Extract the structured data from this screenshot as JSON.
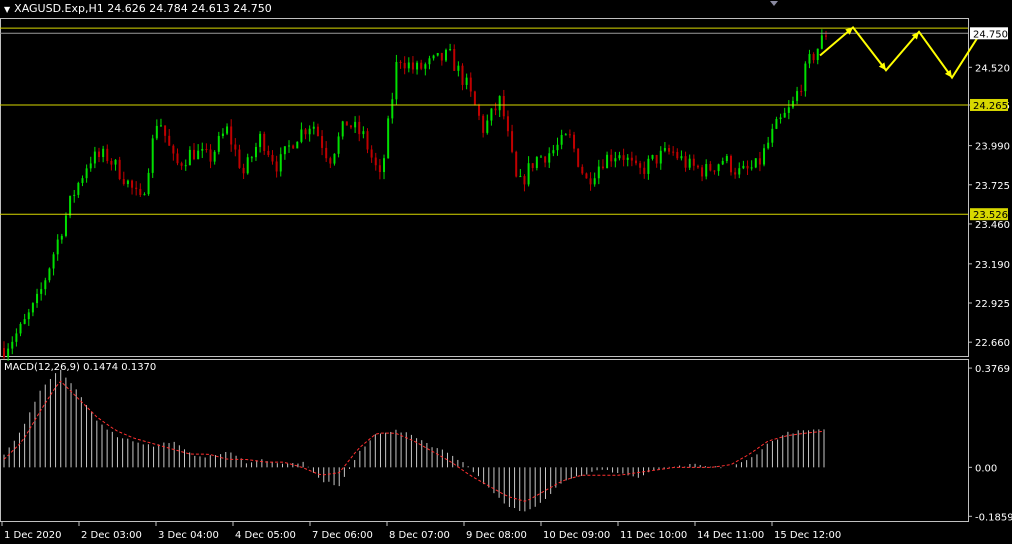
{
  "header": {
    "symbol_line": "XAGUSD.Exp,H1  24.626 24.784 24.613 24.750",
    "macd_label": "MACD(12,26,9) 0.1474 0.1370"
  },
  "colors": {
    "background": "#000000",
    "bull_candle": "#00e000",
    "bear_candle": "#c00000",
    "level_line": "#d8d800",
    "forecast_arrow": "#ffff00",
    "histogram": "#c8c8c8",
    "signal_line": "#ff3030",
    "axis_text": "#ffffff"
  },
  "chart_data": [
    {
      "type": "candlestick",
      "title": "XAGUSD.Exp,H1",
      "price_ticks": [
        "24.520",
        "24.265",
        "23.990",
        "23.725",
        "23.460",
        "23.190",
        "22.925",
        "22.660"
      ],
      "current_price_label": "24.750",
      "level_labels": [
        "24.265",
        "23.526"
      ],
      "levels": [
        24.785,
        24.265,
        23.526
      ],
      "ylim": [
        22.58,
        24.84
      ],
      "x_ticks": [
        "1 Dec 2020",
        "2 Dec 03:00",
        "3 Dec 04:00",
        "4 Dec 05:00",
        "7 Dec 06:00",
        "8 Dec 07:00",
        "9 Dec 08:00",
        "10 Dec 09:00",
        "11 Dec 10:00",
        "14 Dec 11:00",
        "15 Dec 12:00"
      ],
      "close_path": [
        22.62,
        22.75,
        22.95,
        23.3,
        23.65,
        23.9,
        23.92,
        23.78,
        23.6,
        24.2,
        23.85,
        23.95,
        23.9,
        24.1,
        23.8,
        24.05,
        23.85,
        24.05,
        24.15,
        23.9,
        24.15,
        24.05,
        23.75,
        24.6,
        24.5,
        24.55,
        24.6,
        24.4,
        24.1,
        24.3,
        23.7,
        23.9,
        23.95,
        24.05,
        23.75,
        23.9,
        23.95,
        23.8,
        23.9,
        23.95,
        23.85,
        23.82,
        23.9,
        23.8,
        23.85,
        24.1,
        24.25,
        24.55,
        24.75
      ],
      "forecast_path": [
        24.6,
        24.79,
        24.5,
        24.76,
        24.45,
        24.8
      ]
    },
    {
      "type": "bar",
      "title": "MACD(12,26,9)",
      "ticks": [
        "0.3769",
        "0.00",
        "-0.1859"
      ],
      "ylim": [
        -0.2,
        0.4
      ],
      "macd_path": [
        0.05,
        0.15,
        0.3,
        0.37,
        0.28,
        0.18,
        0.12,
        0.1,
        0.08,
        0.1,
        0.05,
        0.04,
        0.06,
        0.02,
        0.03,
        0.01,
        0.02,
        -0.05,
        -0.07,
        0.05,
        0.13,
        0.14,
        0.12,
        0.08,
        0.05,
        0.0,
        -0.08,
        -0.15,
        -0.17,
        -0.12,
        -0.05,
        -0.03,
        -0.01,
        -0.02,
        -0.04,
        -0.01,
        0.0,
        0.01,
        0.0,
        0.0,
        0.03,
        0.09,
        0.13,
        0.14,
        0.14
      ],
      "signal_path": [
        0.03,
        0.1,
        0.22,
        0.33,
        0.26,
        0.19,
        0.14,
        0.11,
        0.09,
        0.07,
        0.05,
        0.05,
        0.03,
        0.03,
        0.02,
        0.02,
        0.0,
        -0.03,
        -0.02,
        0.07,
        0.13,
        0.13,
        0.1,
        0.06,
        0.02,
        -0.03,
        -0.07,
        -0.11,
        -0.13,
        -0.09,
        -0.05,
        -0.03,
        -0.03,
        -0.03,
        -0.02,
        -0.01,
        0.0,
        0.0,
        0.0,
        0.01,
        0.05,
        0.1,
        0.12,
        0.13,
        0.137
      ]
    }
  ]
}
